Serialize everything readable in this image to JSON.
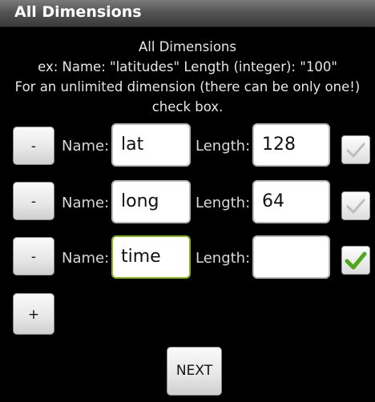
{
  "app": {
    "title": "All Dimensions"
  },
  "header": {
    "heading": "All Dimensions",
    "example": "ex: Name: \"latitudes\" Length (integer): \"100\"",
    "note_line1": "For an unlimited dimension (there can be only one!)",
    "note_line2": "check box."
  },
  "rows": [
    {
      "remove_label": "-",
      "name_label": "Name:",
      "name_value": "lat",
      "length_label": "Length:",
      "length_value": "128",
      "unlimited_checked": false,
      "check_icon": "check-icon-disabled"
    },
    {
      "remove_label": "-",
      "name_label": "Name:",
      "name_value": "long",
      "length_label": "Length:",
      "length_value": "64",
      "unlimited_checked": false,
      "check_icon": "check-icon-disabled"
    },
    {
      "remove_label": "-",
      "name_label": "Name:",
      "name_value": "time",
      "length_label": "Length:",
      "length_value": "",
      "unlimited_checked": true,
      "check_icon": "check-icon-green"
    }
  ],
  "add_label": "+",
  "next_label": "NEXT",
  "colors": {
    "check_green": "#4fa81e",
    "focus_border": "#86b817",
    "title_bar": "#555555"
  }
}
